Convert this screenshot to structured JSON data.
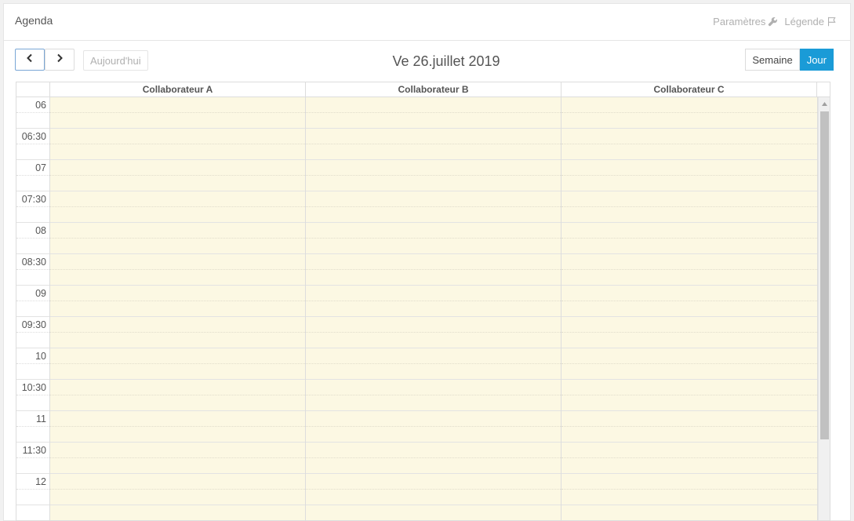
{
  "panel": {
    "title": "Agenda"
  },
  "header_links": {
    "settings_label": "Paramètres",
    "legend_label": "Légende"
  },
  "toolbar": {
    "prev_icon": "chevron-left-icon",
    "next_icon": "chevron-right-icon",
    "today_label": "Aujourd'hui",
    "date_title": "Ve 26.juillet 2019",
    "views": [
      {
        "label": "Semaine",
        "active": false
      },
      {
        "label": "Jour",
        "active": true
      }
    ]
  },
  "calendar": {
    "columns": [
      "Collaborateur A",
      "Collaborateur B",
      "Collaborateur C"
    ],
    "time_labels": [
      "06",
      "06:30",
      "07",
      "07:30",
      "08",
      "08:30",
      "09",
      "09:30",
      "10",
      "10:30",
      "11",
      "11:30",
      "12",
      ""
    ],
    "background_color": "#fcf8e3"
  },
  "colors": {
    "accent": "#1a9bd7"
  }
}
